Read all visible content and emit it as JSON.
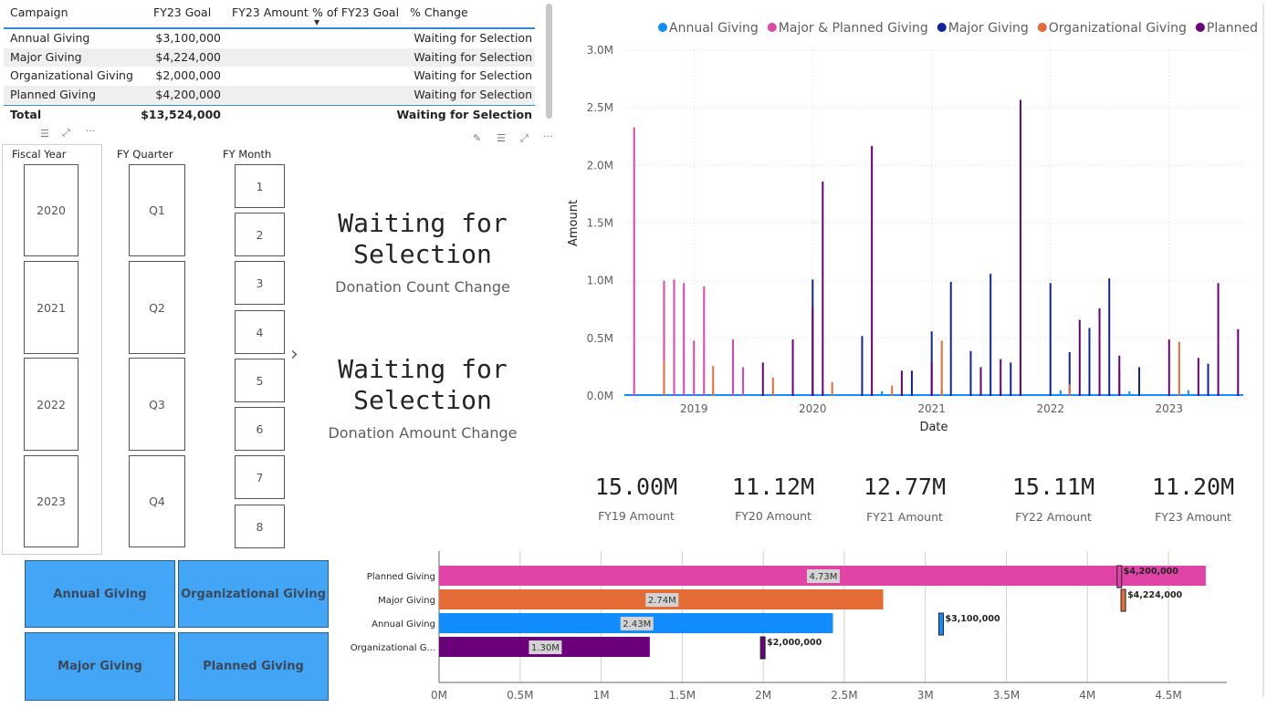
{
  "table": {
    "headers": [
      "Campaign",
      "FY23 Goal",
      "FY23 Amount",
      "% of FY23 Goal",
      "% Change"
    ],
    "rows": [
      {
        "campaign": "Annual Giving",
        "goal": "$3,100,000",
        "amount": "",
        "pct_goal": "",
        "change": "Waiting for Selection"
      },
      {
        "campaign": "Major Giving",
        "goal": "$4,224,000",
        "amount": "",
        "pct_goal": "",
        "change": "Waiting for Selection"
      },
      {
        "campaign": "Organizational Giving",
        "goal": "$2,000,000",
        "amount": "",
        "pct_goal": "",
        "change": "Waiting for Selection"
      },
      {
        "campaign": "Planned Giving",
        "goal": "$4,200,000",
        "amount": "",
        "pct_goal": "",
        "change": "Waiting for Selection"
      }
    ],
    "total": {
      "label": "Total",
      "goal": "$13,524,000",
      "change": "Waiting for Selection"
    },
    "sort_icon": "sort-descending-icon"
  },
  "slicers": {
    "fiscal_year": {
      "title": "Fiscal Year",
      "items": [
        "2020",
        "2021",
        "2022",
        "2023"
      ]
    },
    "fy_quarter": {
      "title": "FY Quarter",
      "items": [
        "Q1",
        "Q2",
        "Q3",
        "Q4"
      ]
    },
    "fy_month": {
      "title": "FY Month",
      "items": [
        "1",
        "2",
        "3",
        "4",
        "5",
        "6",
        "7",
        "8"
      ]
    }
  },
  "cards": {
    "count": {
      "value": "Waiting for Selection",
      "line1": "Waiting for",
      "line2": "Selection",
      "label": "Donation Count Change"
    },
    "amount": {
      "value": "Waiting for Selection",
      "line1": "Waiting for",
      "line2": "Selection",
      "label": "Donation Amount Change"
    }
  },
  "kpis": [
    {
      "value": "15.00M",
      "label": "FY19 Amount"
    },
    {
      "value": "11.12M",
      "label": "FY20 Amount"
    },
    {
      "value": "12.77M",
      "label": "FY21 Amount"
    },
    {
      "value": "15.11M",
      "label": "FY22 Amount"
    },
    {
      "value": "11.20M",
      "label": "FY23 Amount"
    }
  ],
  "buttons": [
    "Annual Giving",
    "Organizational Giving",
    "Major Giving",
    "Planned Giving"
  ],
  "colors": {
    "annual": "#118dff",
    "major_planned": "#e044a7",
    "major": "#12239e",
    "organizational": "#e66c37",
    "planned": "#6b007b",
    "accent": "#2f8cd4",
    "button": "#42a5f5"
  },
  "chart_data": [
    {
      "type": "line",
      "xlabel": "Date",
      "ylabel": "Amount",
      "x_ticks": [
        "2019",
        "2020",
        "2021",
        "2022",
        "2023"
      ],
      "y_ticks": [
        "0.0M",
        "0.5M",
        "1.0M",
        "1.5M",
        "2.0M",
        "2.5M",
        "3.0M"
      ],
      "ylim": [
        0,
        3000000
      ],
      "legend_position": "top",
      "grid": true,
      "series": [
        {
          "name": "Annual Giving",
          "color": "#118dff",
          "points": [
            [
              "2019-03",
              0.03
            ],
            [
              "2019-09",
              0.04
            ],
            [
              "2020-02",
              0.05
            ],
            [
              "2020-08",
              0.04
            ],
            [
              "2021-02",
              0.05
            ],
            [
              "2021-08",
              0.04
            ],
            [
              "2022-02",
              0.05
            ],
            [
              "2022-09",
              0.04
            ],
            [
              "2023-03",
              0.05
            ]
          ]
        },
        {
          "name": "Major & Planned Giving",
          "color": "#e044a7",
          "points": [
            [
              "2018-07",
              2.33
            ],
            [
              "2018-10",
              1.0
            ],
            [
              "2018-11",
              1.01
            ],
            [
              "2018-12",
              0.98
            ],
            [
              "2019-01",
              0.48
            ],
            [
              "2019-02",
              0.95
            ],
            [
              "2019-05",
              0.49
            ],
            [
              "2019-06",
              0.25
            ]
          ]
        },
        {
          "name": "Major Giving",
          "color": "#12239e",
          "points": [
            [
              "2020-01",
              1.01
            ],
            [
              "2020-06",
              0.52
            ],
            [
              "2020-11",
              0.22
            ],
            [
              "2021-01",
              0.56
            ],
            [
              "2021-03",
              0.99
            ],
            [
              "2021-05",
              0.39
            ],
            [
              "2021-07",
              1.06
            ],
            [
              "2021-09",
              0.29
            ],
            [
              "2022-01",
              0.98
            ],
            [
              "2022-03",
              0.38
            ],
            [
              "2022-05",
              0.59
            ],
            [
              "2022-07",
              1.02
            ],
            [
              "2022-10",
              0.25
            ],
            [
              "2023-05",
              0.28
            ]
          ]
        },
        {
          "name": "Organizational Giving",
          "color": "#e66c37",
          "points": [
            [
              "2018-10",
              0.3
            ],
            [
              "2019-03",
              0.26
            ],
            [
              "2019-09",
              0.16
            ],
            [
              "2020-03",
              0.12
            ],
            [
              "2020-09",
              0.09
            ],
            [
              "2021-02",
              0.48
            ],
            [
              "2022-03",
              0.1
            ],
            [
              "2022-08",
              0.22
            ],
            [
              "2023-02",
              0.47
            ]
          ]
        },
        {
          "name": "Planned Giving",
          "color": "#6b007b",
          "points": [
            [
              "2019-08",
              0.29
            ],
            [
              "2019-11",
              0.49
            ],
            [
              "2020-01",
              0.77
            ],
            [
              "2020-02",
              1.86
            ],
            [
              "2020-07",
              2.17
            ],
            [
              "2020-10",
              0.22
            ],
            [
              "2021-01",
              0.3
            ],
            [
              "2021-06",
              0.25
            ],
            [
              "2021-08",
              0.32
            ],
            [
              "2021-10",
              2.57
            ],
            [
              "2022-04",
              0.66
            ],
            [
              "2022-06",
              0.76
            ],
            [
              "2022-08",
              0.35
            ],
            [
              "2023-01",
              0.49
            ],
            [
              "2023-04",
              0.33
            ],
            [
              "2023-06",
              0.98
            ],
            [
              "2023-08",
              0.58
            ]
          ]
        }
      ]
    },
    {
      "type": "bar",
      "orientation": "horizontal",
      "categories": [
        "Planned Giving",
        "Major Giving",
        "Annual Giving",
        "Organizational G..."
      ],
      "values": [
        4730000,
        2740000,
        2430000,
        1300000
      ],
      "value_labels": [
        "4.73M",
        "2.74M",
        "2.43M",
        "1.30M"
      ],
      "colors": [
        "#e044a7",
        "#e66c37",
        "#118dff",
        "#6b007b"
      ],
      "targets": [
        4200000,
        4224000,
        3100000,
        2000000
      ],
      "target_labels": [
        "$4,200,000",
        "$4,224,000",
        "$3,100,000",
        "$2,000,000"
      ],
      "x_ticks": [
        "0M",
        "0.5M",
        "1M",
        "1.5M",
        "2M",
        "2.5M",
        "3M",
        "3.5M",
        "4M",
        "4.5M"
      ],
      "xlim": [
        0,
        4800000
      ],
      "grid": true
    }
  ]
}
